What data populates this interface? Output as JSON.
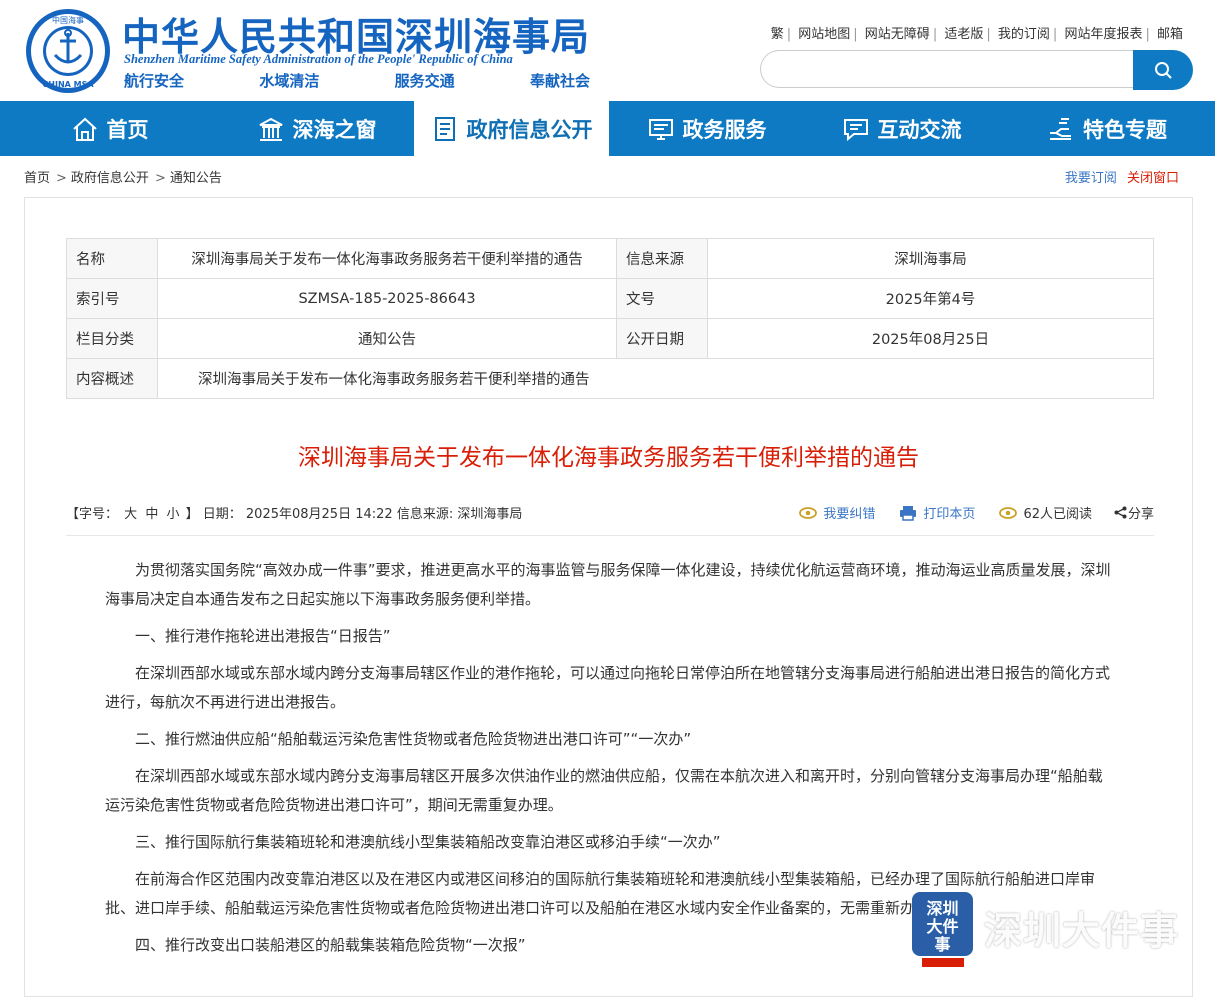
{
  "header": {
    "site_title": "中华人民共和国深圳海事局",
    "site_subtitle": "Shenzhen Maritime Safety Administration of the People' Republic of China",
    "slogans": [
      "航行安全",
      "水域清洁",
      "服务交通",
      "奉献社会"
    ],
    "emblem_text": [
      "中国海事",
      "CHINA MSA"
    ],
    "top_links": [
      "繁",
      "网站地图",
      "网站无障碍",
      "适老版",
      "我的订阅",
      "网站年度报表",
      "邮箱"
    ],
    "search_placeholder": ""
  },
  "nav": [
    {
      "label": "首页",
      "icon": "home-icon"
    },
    {
      "label": "深海之窗",
      "icon": "building-icon"
    },
    {
      "label": "政府信息公开",
      "icon": "document-icon"
    },
    {
      "label": "政务服务",
      "icon": "monitor-icon"
    },
    {
      "label": "互动交流",
      "icon": "chat-icon"
    },
    {
      "label": "特色专题",
      "icon": "hand-icon"
    }
  ],
  "active_nav": "政府信息公开",
  "breadcrumb": [
    "首页",
    "政府信息公开",
    "通知公告"
  ],
  "breadcrumb_right": {
    "subscribe": "我要订阅",
    "close": "关闭窗口"
  },
  "meta": {
    "name_label": "名称",
    "name_value": "深圳海事局关于发布一体化海事政务服务若干便利举措的通告",
    "source_label": "信息来源",
    "source_value": "深圳海事局",
    "index_label": "索引号",
    "index_value": "SZMSA-185-2025-86643",
    "docno_label": "文号",
    "docno_value": "2025年第4号",
    "category_label": "栏目分类",
    "category_value": "通知公告",
    "date_label": "公开日期",
    "date_value": "2025年08月25日",
    "summary_label": "内容概述",
    "summary_value": "深圳海事局关于发布一体化海事政务服务若干便利举措的通告"
  },
  "article": {
    "title": "深圳海事局关于发布一体化海事政务服务若干便利举措的通告",
    "font_label": "【字号：",
    "font_sizes": [
      "大",
      "中",
      "小"
    ],
    "font_end": "】",
    "date_text": "日期： 2025年08月25日 14:22",
    "source_text": "信息来源: 深圳海事局",
    "actions": {
      "correct": "我要纠错",
      "print": "打印本页",
      "reads": "62人已阅读",
      "share": "分享"
    },
    "paragraphs": [
      "为贯彻落实国务院“高效办成一件事”要求，推进更高水平的海事监管与服务保障一体化建设，持续优化航运营商环境，推动海运业高质量发展，深圳海事局决定自本通告发布之日起实施以下海事政务服务便利举措。",
      "一、推行港作拖轮进出港报告“日报告”",
      "在深圳西部水域或东部水域内跨分支海事局辖区作业的港作拖轮，可以通过向拖轮日常停泊所在地管辖分支海事局进行船舶进出港日报告的简化方式进行，每航次不再进行进出港报告。",
      "二、推行燃油供应船“船舶载运污染危害性货物或者危险货物进出港口许可”“一次办”",
      "在深圳西部水域或东部水域内跨分支海事局辖区开展多次供油作业的燃油供应船，仅需在本航次进入和离开时，分别向管辖分支海事局办理“船舶载运污染危害性货物或者危险货物进出港口许可”，期间无需重复办理。",
      "三、推行国际航行集装箱班轮和港澳航线小型集装箱船改变靠泊港区或移泊手续“一次办”",
      "在前海合作区范围内改变靠泊港区以及在港区内或港区间移泊的国际航行集装箱班轮和港澳航线小型集装箱船，已经办理了国际航行船舶进口岸审批、进口岸手续、船舶载运污染危害性货物或者危险货物进出港口许可以及船舶在港区水域内安全作业备案的，无需重新办理。",
      "四、推行改变出口装船港区的船载集装箱危险货物“一次报”"
    ]
  },
  "watermark": {
    "logo_text": "深圳大件事",
    "text": "深圳大件事"
  },
  "colors": {
    "brand_blue": "#0e7ac4",
    "title_red": "#d81e06",
    "header_blue": "#1565c0"
  }
}
